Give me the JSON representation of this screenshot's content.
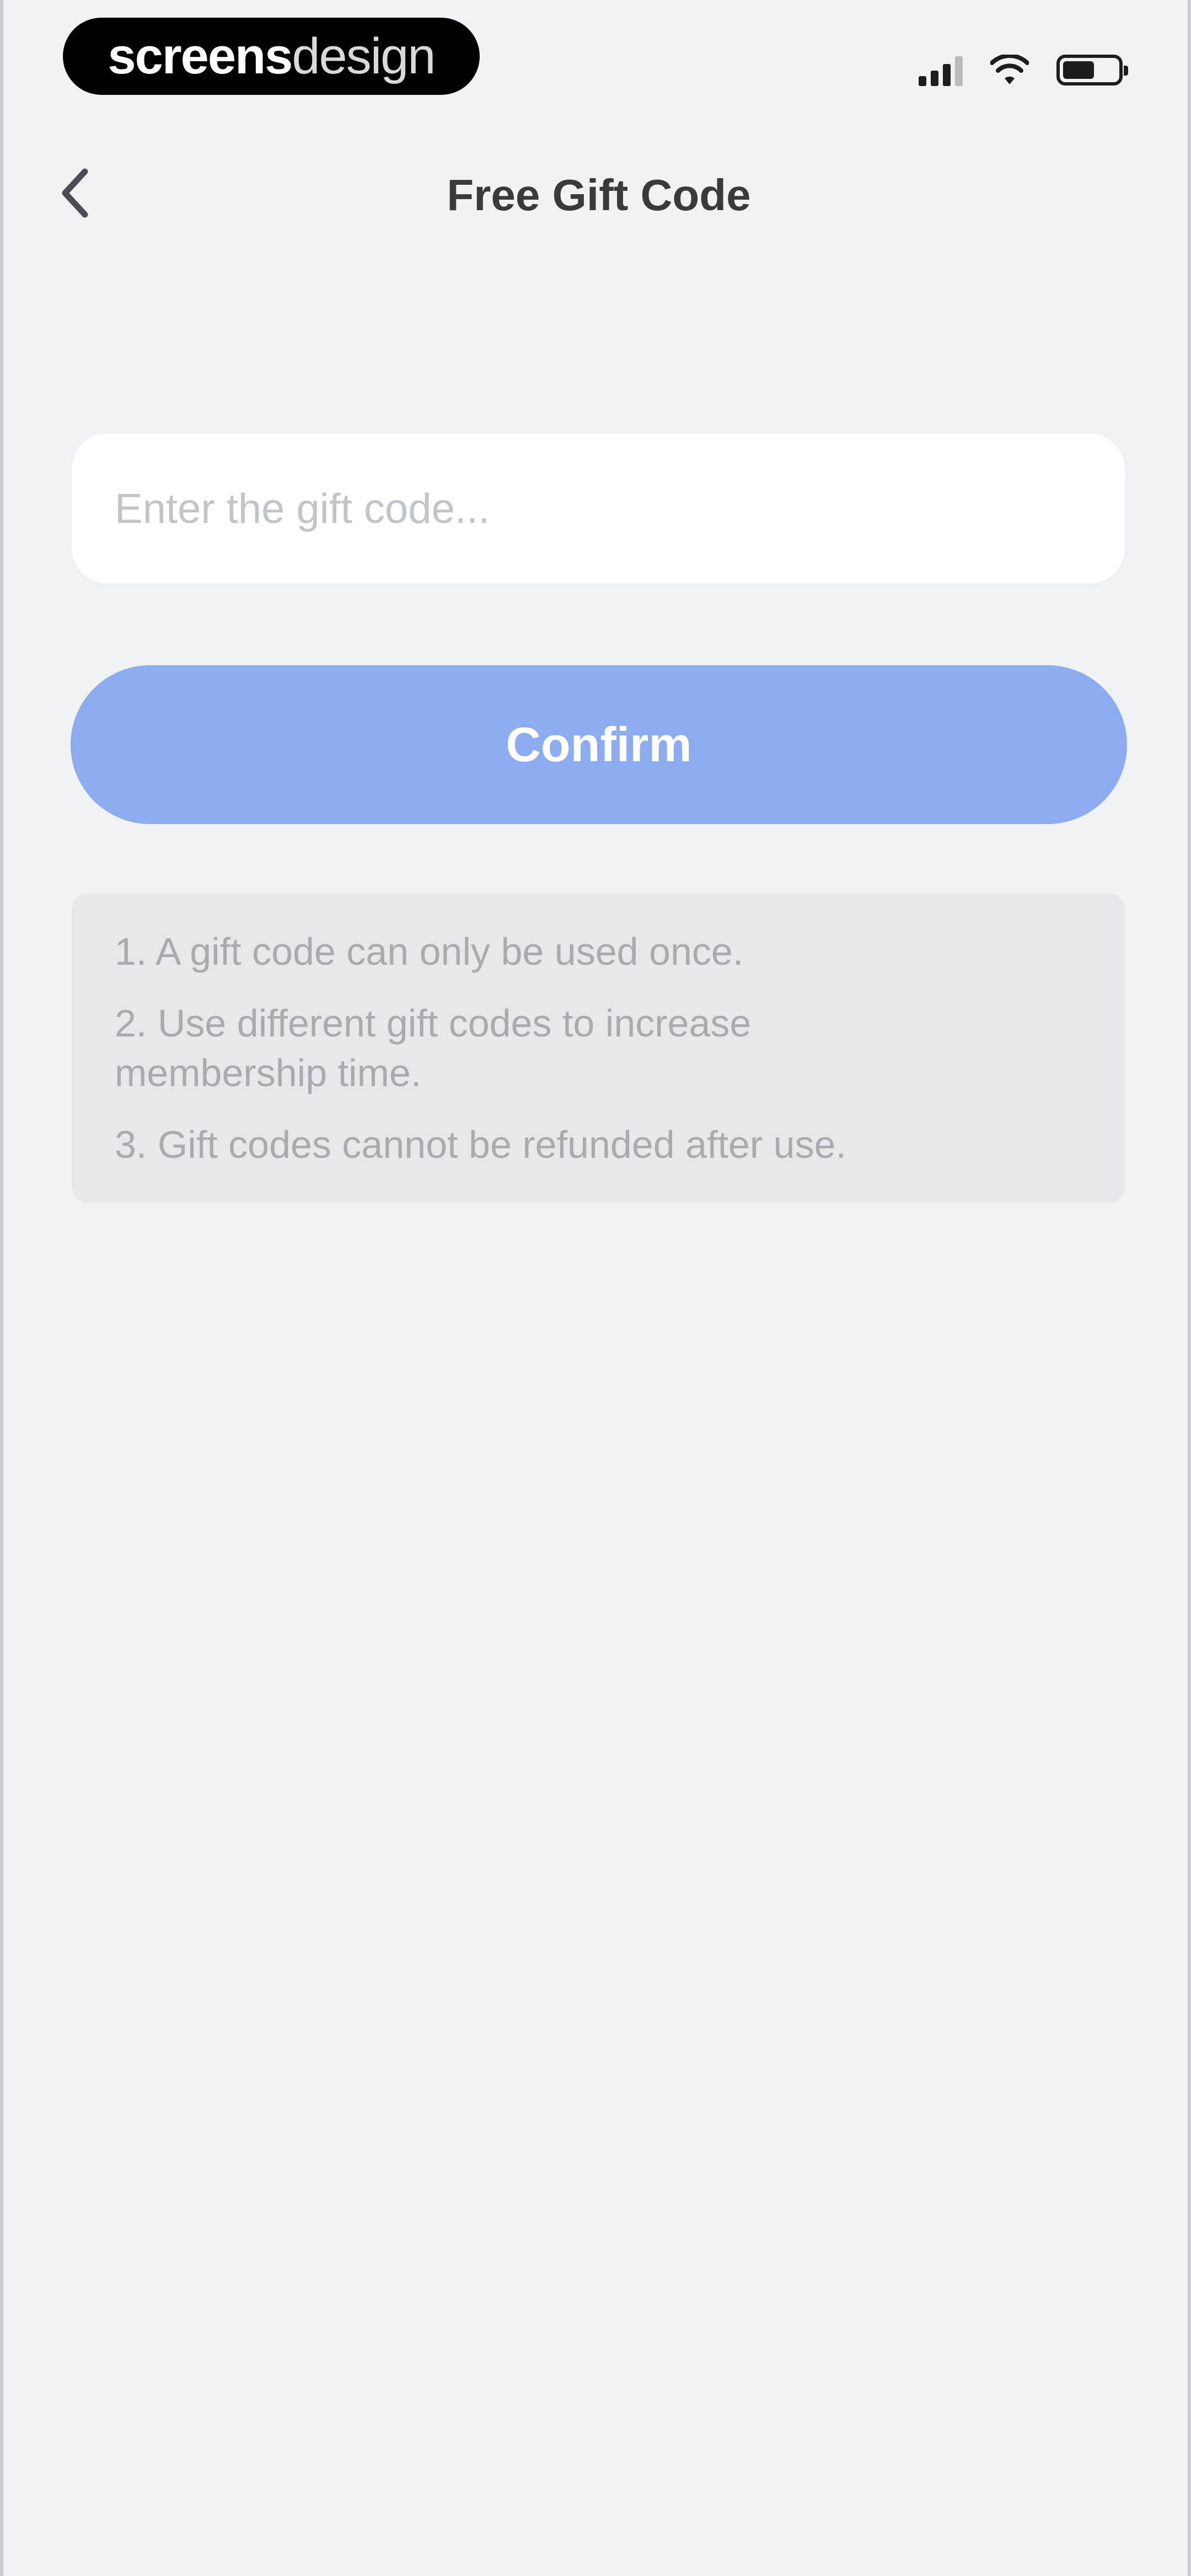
{
  "status_bar": {
    "brand_bold": "screens",
    "brand_light": "design",
    "icons": [
      "signal-icon",
      "wifi-icon",
      "battery-icon"
    ]
  },
  "nav": {
    "title": "Free Gift Code",
    "back_icon": "chevron-left-icon"
  },
  "form": {
    "placeholder": "Enter the gift code...",
    "value": "",
    "confirm_label": "Confirm"
  },
  "notes": [
    "1. A gift code can only be used once.",
    "2. Use different gift codes to increase membership time.",
    "3. Gift codes cannot be refunded after use."
  ],
  "colors": {
    "background": "#f1f2f4",
    "primary_disabled": "#8dacf0",
    "notes_background": "#e7e8eb",
    "notes_text": "#a9abb0"
  }
}
